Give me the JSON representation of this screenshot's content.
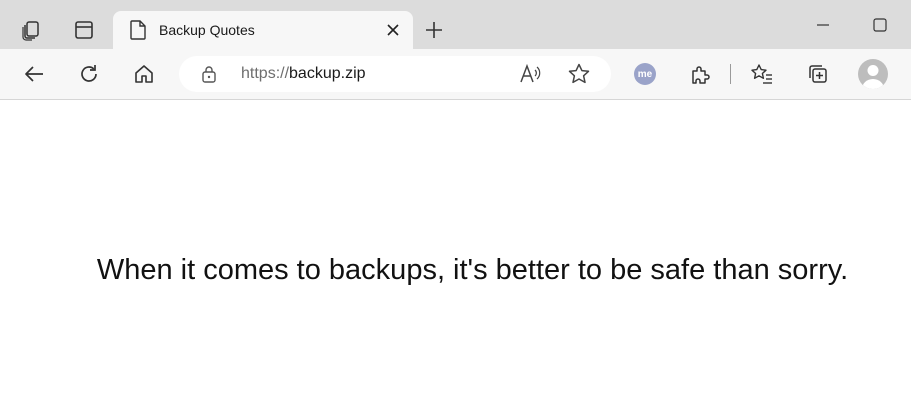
{
  "tab": {
    "title": "Backup Quotes"
  },
  "address_bar": {
    "url_scheme": "https://",
    "url_host": "backup.zip"
  },
  "extensions": {
    "me_badge_label": "me"
  },
  "page": {
    "quote": "When it comes to backups, it's better to be safe than sorry."
  },
  "colors": {
    "tabstrip": "#dcdcdc",
    "toolbar": "#f7f7f7",
    "me_badge": "#9aa3c9"
  }
}
